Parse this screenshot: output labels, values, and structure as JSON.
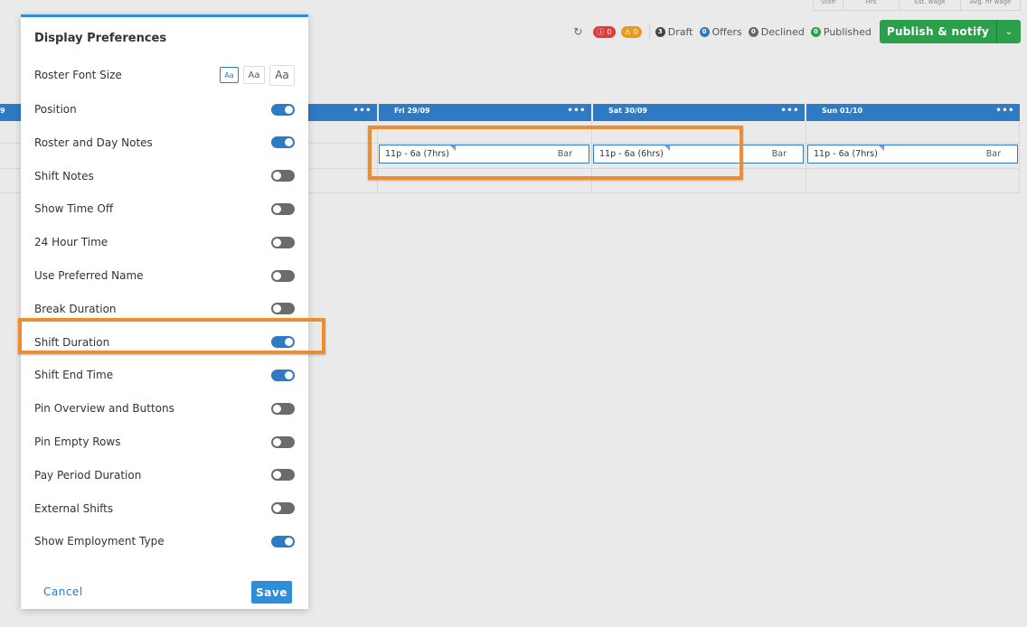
{
  "stats_header": [
    "Staff",
    "Hrs",
    "Est. wage",
    "Avg. hr wage"
  ],
  "toolbar": {
    "error_count": "0",
    "warning_count": "0",
    "draft": {
      "count": "3",
      "label": "Draft",
      "color": "#444444"
    },
    "offers": {
      "count": "0",
      "label": "Offers",
      "color": "#2e7ac4"
    },
    "declined": {
      "count": "0",
      "label": "Declined",
      "color": "#666666"
    },
    "published": {
      "count": "0",
      "label": "Published",
      "color": "#2aa04a"
    },
    "publish_label": "Publish & notify"
  },
  "roster": {
    "first_col_fragment": "9",
    "days": [
      {
        "label": "Fri 29/09"
      },
      {
        "label": "Sat 30/09"
      },
      {
        "label": "Sun 01/10"
      }
    ],
    "shifts": [
      {
        "time": "11p - 6a (7hrs)",
        "role": "Bar"
      },
      {
        "time": "11p - 6a (6hrs)",
        "role": "Bar"
      },
      {
        "time": "11p - 6a (7hrs)",
        "role": "Bar"
      }
    ]
  },
  "modal": {
    "title": "Display Preferences",
    "font_size_label": "Roster Font Size",
    "font_sizes": [
      "Aa",
      "Aa",
      "Aa"
    ],
    "preferences": [
      {
        "label": "Position",
        "on": true
      },
      {
        "label": "Roster and Day Notes",
        "on": true
      },
      {
        "label": "Shift Notes",
        "on": false
      },
      {
        "label": "Show Time Off",
        "on": false
      },
      {
        "label": "24 Hour Time",
        "on": false
      },
      {
        "label": "Use Preferred Name",
        "on": false
      },
      {
        "label": "Break Duration",
        "on": false
      },
      {
        "label": "Shift Duration",
        "on": true
      },
      {
        "label": "Shift End Time",
        "on": true
      },
      {
        "label": "Pin Overview and Buttons",
        "on": false
      },
      {
        "label": "Pin Empty Rows",
        "on": false
      },
      {
        "label": "Pay Period Duration",
        "on": false
      },
      {
        "label": "External Shifts",
        "on": false
      },
      {
        "label": "Show Employment Type",
        "on": true
      }
    ],
    "cancel_label": "Cancel",
    "save_label": "Save"
  },
  "colors": {
    "accent": "#2e7ac4",
    "highlight": "#f08c2e",
    "publish": "#2aa04a"
  }
}
